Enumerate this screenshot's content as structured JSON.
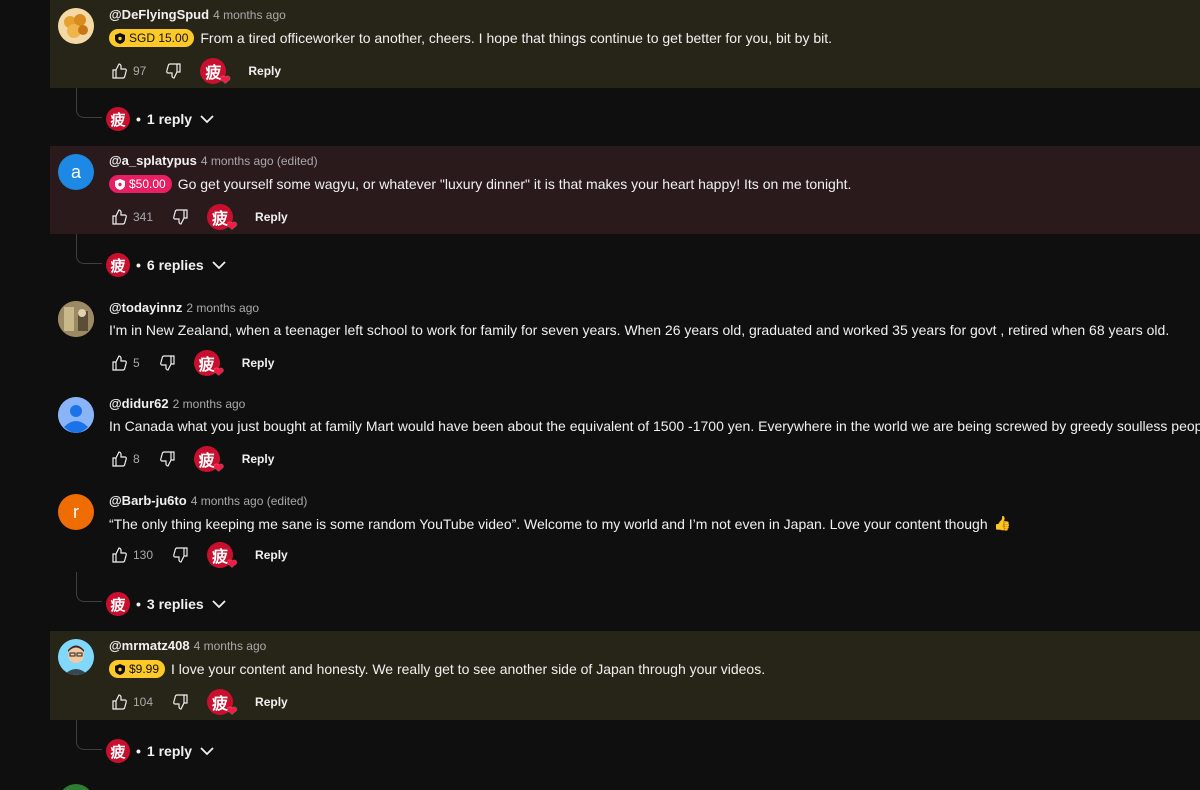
{
  "comments": [
    {
      "author": "@DeFlyingSpud",
      "time": "4 months ago",
      "badge": "SGD 15.00",
      "text": "From a tired officeworker to another, cheers.  I hope that things continue to get better for you, bit by bit.",
      "likes": "97",
      "reply": "Reply",
      "replies": "1 reply",
      "avatar": "food-avatar"
    },
    {
      "author": "@a_splatypus",
      "time": "4 months ago (edited)",
      "badge": "$50.00",
      "text": "Go get yourself some wagyu, or whatever \"luxury dinner\" it is that makes your heart happy! Its on me tonight.",
      "likes": "341",
      "reply": "Reply",
      "replies": "6 replies",
      "avatar_letter": "a"
    },
    {
      "author": "@todayinnz",
      "time": "2 months ago",
      "text": "I'm in New Zealand, when a teenager left school to work  for  family for seven years. When  26 years old, graduated and worked 35 years for govt ,  retired when 68 years old.",
      "likes": "5",
      "reply": "Reply"
    },
    {
      "author": "@didur62",
      "time": "2 months ago",
      "text": "In Canada what you just bought at family Mart would have been about the equivalent of 1500 -1700 yen. Everywhere in the world we are being screwed by greedy soulless people.",
      "likes": "8",
      "reply": "Reply"
    },
    {
      "author": "@Barb-ju6to",
      "time": "4 months ago (edited)",
      "text": "“The only thing keeping me sane is some random YouTube video”.  Welcome to my world and I’m not even in Japan. Love your content though",
      "emoji": "👍",
      "likes": "130",
      "reply": "Reply",
      "replies": "3 replies",
      "avatar_letter": "r"
    },
    {
      "author": "@mrmatz408",
      "time": "4 months ago",
      "badge": "$9.99",
      "text": "I love your content and honesty.  We really get to see another side of Japan through your videos.",
      "likes": "104",
      "reply": "Reply",
      "replies": "1 reply"
    }
  ],
  "creator_glyph": "疲",
  "heart_glyph": "❤",
  "bullet": "•",
  "colors": {
    "accent_red": "#c8102e",
    "badge_yellow": "#ffca28",
    "badge_pink": "#e91e63",
    "avatar_blue": "#1e88e5",
    "avatar_orange": "#ef6c00"
  }
}
